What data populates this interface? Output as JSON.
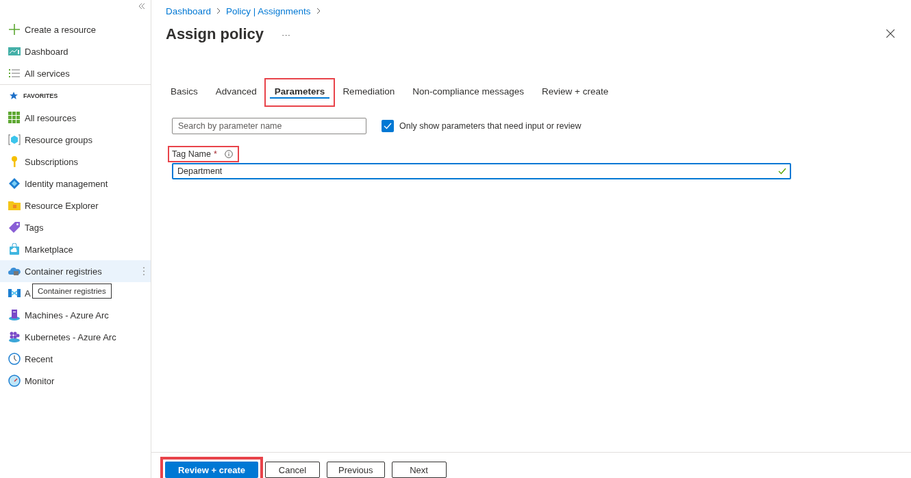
{
  "sidebar": {
    "top_items": [
      {
        "label": "Create a resource",
        "hovered": false
      },
      {
        "label": "Dashboard",
        "hovered": false
      },
      {
        "label": "All services",
        "hovered": false
      }
    ],
    "favorites_header": "FAVORITES",
    "favorites": [
      {
        "label": "All resources",
        "hovered": false
      },
      {
        "label": "Resource groups",
        "hovered": false
      },
      {
        "label": "Subscriptions",
        "hovered": false
      },
      {
        "label": "Identity management",
        "hovered": false
      },
      {
        "label": "Resource Explorer",
        "hovered": false
      },
      {
        "label": "Tags",
        "hovered": false
      },
      {
        "label": "Marketplace",
        "hovered": false
      },
      {
        "label": "Container registries",
        "hovered": true
      },
      {
        "label": "A",
        "hovered": false
      },
      {
        "label": "Machines - Azure Arc",
        "hovered": false
      },
      {
        "label": "Kubernetes - Azure Arc",
        "hovered": false
      },
      {
        "label": "Recent",
        "hovered": false
      },
      {
        "label": "Monitor",
        "hovered": false
      }
    ],
    "tooltip": "Container registries"
  },
  "breadcrumb": [
    "Dashboard",
    "Policy | Assignments"
  ],
  "title": "Assign policy",
  "title_more": "···",
  "tabs": [
    {
      "label": "Basics",
      "selected": false,
      "highlighted": false
    },
    {
      "label": "Advanced",
      "selected": false,
      "highlighted": false
    },
    {
      "label": "Parameters",
      "selected": true,
      "highlighted": true
    },
    {
      "label": "Remediation",
      "selected": false,
      "highlighted": false
    },
    {
      "label": "Non-compliance messages",
      "selected": false,
      "highlighted": false
    },
    {
      "label": "Review + create",
      "selected": false,
      "highlighted": false
    }
  ],
  "search": {
    "placeholder": "Search by parameter name"
  },
  "filter": {
    "label": "Only show parameters that need input or review",
    "checked": true
  },
  "parameters": [
    {
      "label": "Tag Name",
      "required_mark": "*",
      "value": "Department",
      "valid": true,
      "highlighted": true
    }
  ],
  "footer_buttons": [
    {
      "label": "Review + create",
      "kind": "primary",
      "highlighted": true
    },
    {
      "label": "Cancel",
      "kind": "secondary",
      "highlighted": false
    },
    {
      "label": "Previous",
      "kind": "secondary",
      "highlighted": false
    },
    {
      "label": "Next",
      "kind": "secondary",
      "highlighted": false
    }
  ]
}
